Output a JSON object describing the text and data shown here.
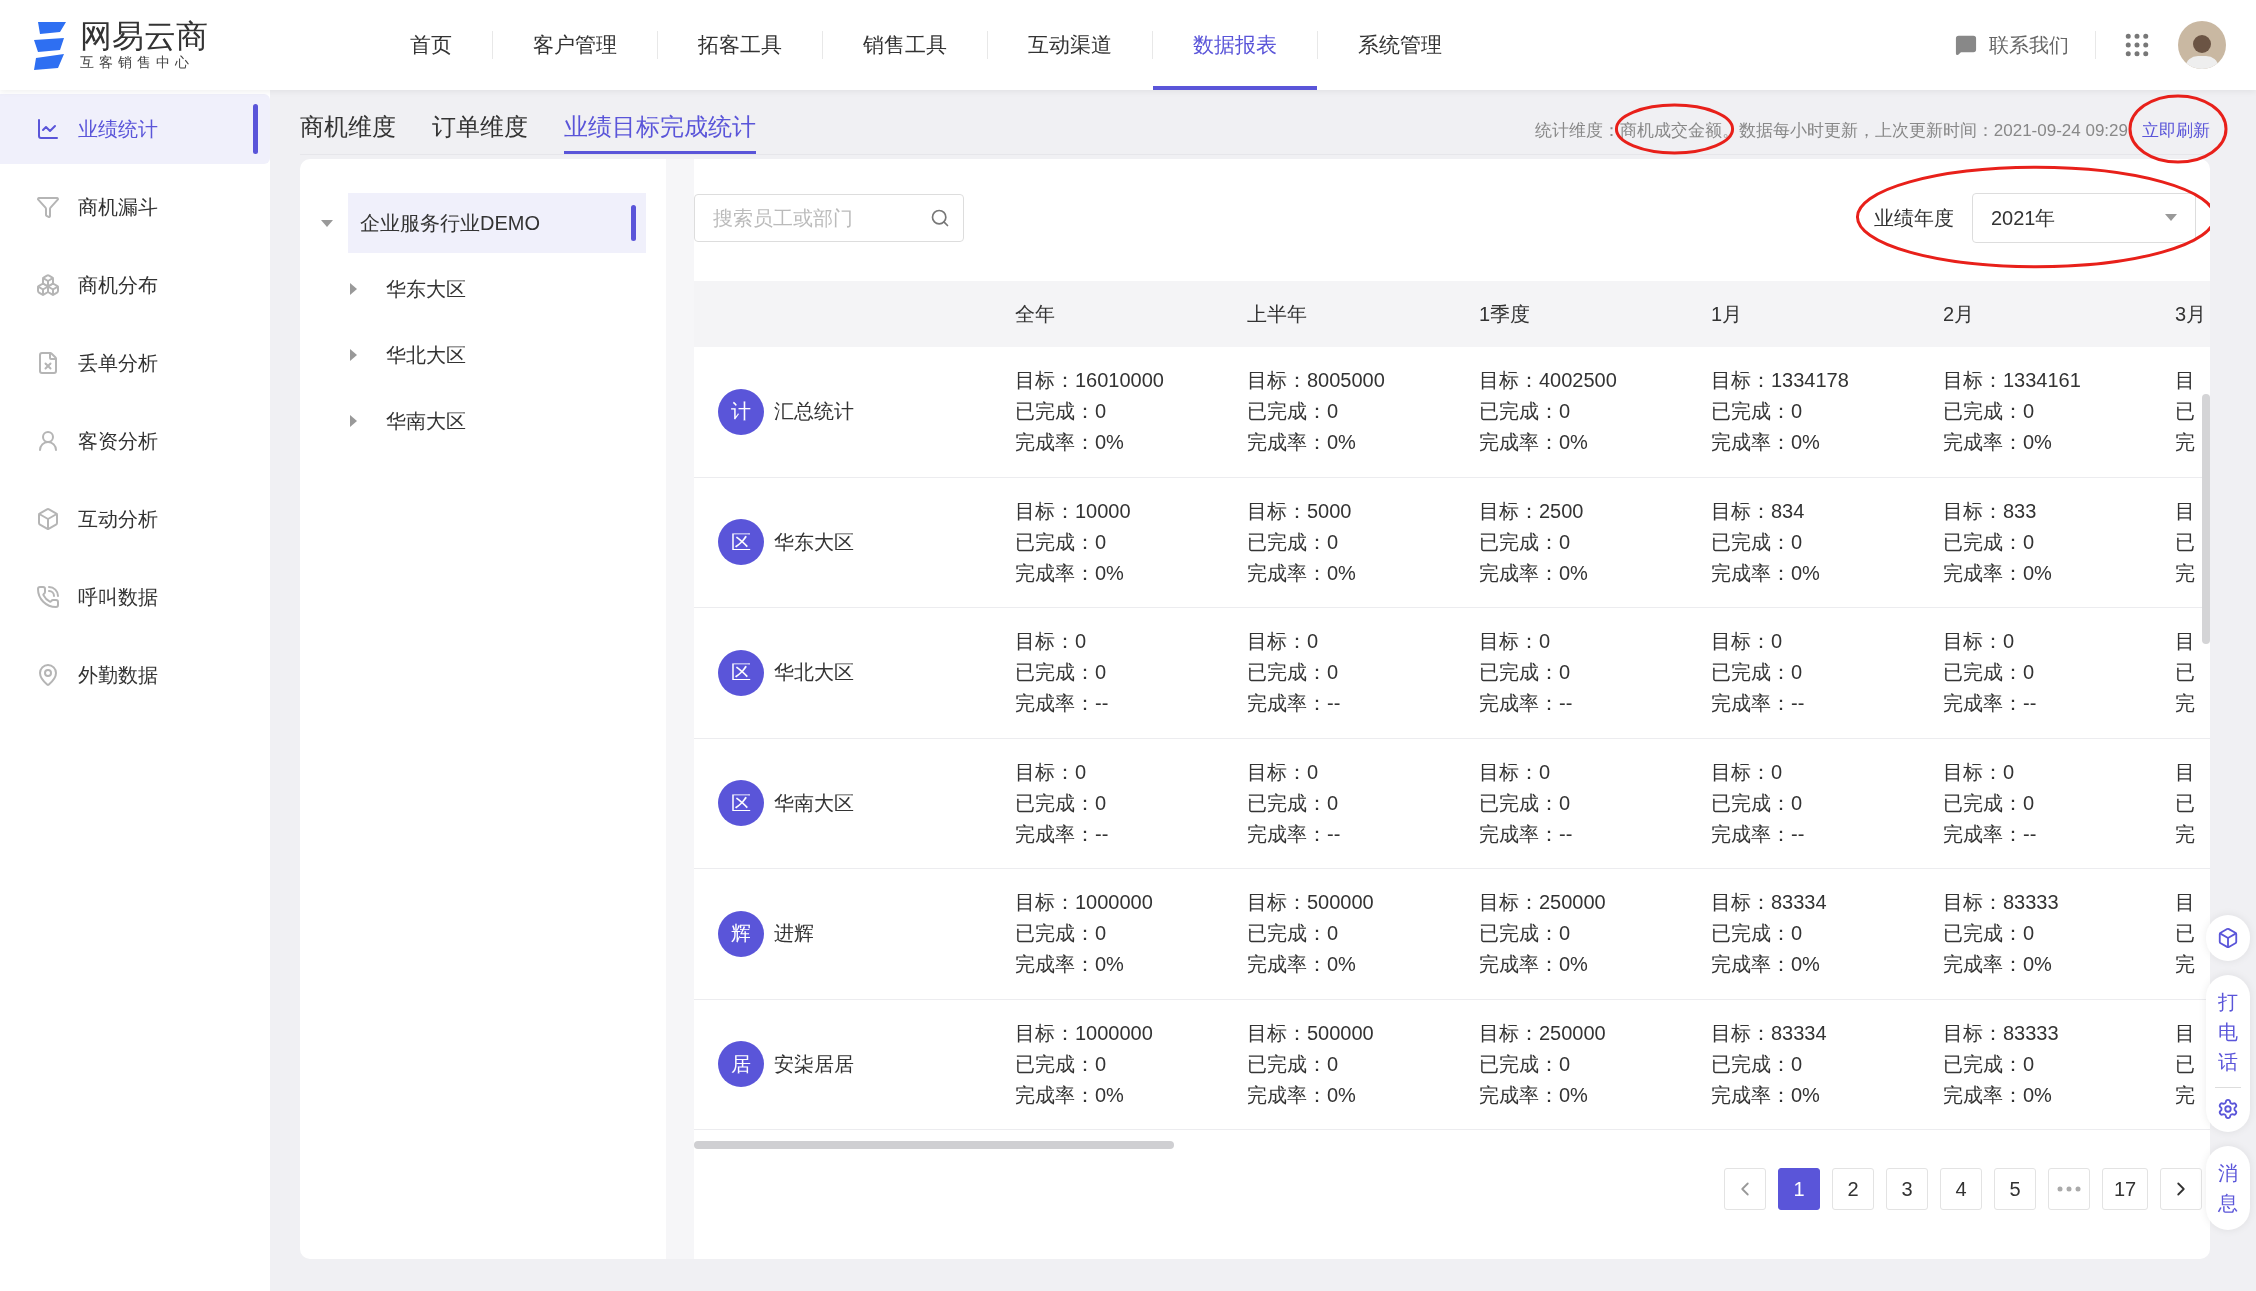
{
  "header": {
    "logo": {
      "name": "网易云商",
      "subtitle": "互客销售中心"
    },
    "nav": [
      {
        "label": "首页",
        "selected": false
      },
      {
        "label": "客户管理",
        "selected": false
      },
      {
        "label": "拓客工具",
        "selected": false
      },
      {
        "label": "销售工具",
        "selected": false
      },
      {
        "label": "互动渠道",
        "selected": false
      },
      {
        "label": "数据报表",
        "selected": true
      },
      {
        "label": "系统管理",
        "selected": false
      }
    ],
    "contact": "联系我们"
  },
  "sidebar": {
    "items": [
      {
        "label": "业绩统计",
        "selected": true
      },
      {
        "label": "商机漏斗",
        "selected": false
      },
      {
        "label": "商机分布",
        "selected": false
      },
      {
        "label": "丢单分析",
        "selected": false
      },
      {
        "label": "客资分析",
        "selected": false
      },
      {
        "label": "互动分析",
        "selected": false
      },
      {
        "label": "呼叫数据",
        "selected": false
      },
      {
        "label": "外勤数据",
        "selected": false
      }
    ]
  },
  "tabs": [
    {
      "label": "商机维度",
      "selected": false
    },
    {
      "label": "订单维度",
      "selected": false
    },
    {
      "label": "业绩目标完成统计",
      "selected": true
    }
  ],
  "status": {
    "text": "统计维度：商机成交金额。数据每小时更新，上次更新时间：2021-09-24 09:29",
    "circled": true,
    "refresh": "立即刷新",
    "refresh_circled": true
  },
  "tree": {
    "label": "企业服务行业DEMO",
    "expanded": true,
    "selected": true,
    "children": [
      {
        "label": "华东大区",
        "expanded": false,
        "selected": false
      },
      {
        "label": "华北大区",
        "expanded": false,
        "selected": false
      },
      {
        "label": "华南大区",
        "expanded": false,
        "selected": false
      }
    ]
  },
  "search": {
    "placeholder": "搜索员工或部门"
  },
  "year_filter": {
    "label": "业绩年度",
    "value": "2021年",
    "circled": true
  },
  "table": {
    "columns": [
      "全年",
      "上半年",
      "1季度",
      "1月",
      "2月",
      "3月"
    ],
    "rows": [
      {
        "badge": "计",
        "name": "汇总统计",
        "cells": [
          [
            "目标：16010000",
            "已完成：0",
            "完成率：0%"
          ],
          [
            "目标：8005000",
            "已完成：0",
            "完成率：0%"
          ],
          [
            "目标：4002500",
            "已完成：0",
            "完成率：0%"
          ],
          [
            "目标：1334178",
            "已完成：0",
            "完成率：0%"
          ],
          [
            "目标：1334161",
            "已完成：0",
            "完成率：0%"
          ],
          [
            "目",
            "已",
            "完"
          ]
        ]
      },
      {
        "badge": "区",
        "name": "华东大区",
        "cells": [
          [
            "目标：10000",
            "已完成：0",
            "完成率：0%"
          ],
          [
            "目标：5000",
            "已完成：0",
            "完成率：0%"
          ],
          [
            "目标：2500",
            "已完成：0",
            "完成率：0%"
          ],
          [
            "目标：834",
            "已完成：0",
            "完成率：0%"
          ],
          [
            "目标：833",
            "已完成：0",
            "完成率：0%"
          ],
          [
            "目",
            "已",
            "完"
          ]
        ]
      },
      {
        "badge": "区",
        "name": "华北大区",
        "cells": [
          [
            "目标：0",
            "已完成：0",
            "完成率：--"
          ],
          [
            "目标：0",
            "已完成：0",
            "完成率：--"
          ],
          [
            "目标：0",
            "已完成：0",
            "完成率：--"
          ],
          [
            "目标：0",
            "已完成：0",
            "完成率：--"
          ],
          [
            "目标：0",
            "已完成：0",
            "完成率：--"
          ],
          [
            "目",
            "已",
            "完"
          ]
        ]
      },
      {
        "badge": "区",
        "name": "华南大区",
        "cells": [
          [
            "目标：0",
            "已完成：0",
            "完成率：--"
          ],
          [
            "目标：0",
            "已完成：0",
            "完成率：--"
          ],
          [
            "目标：0",
            "已完成：0",
            "完成率：--"
          ],
          [
            "目标：0",
            "已完成：0",
            "完成率：--"
          ],
          [
            "目标：0",
            "已完成：0",
            "完成率：--"
          ],
          [
            "目",
            "已",
            "完"
          ]
        ]
      },
      {
        "badge": "辉",
        "name": "进辉",
        "cells": [
          [
            "目标：1000000",
            "已完成：0",
            "完成率：0%"
          ],
          [
            "目标：500000",
            "已完成：0",
            "完成率：0%"
          ],
          [
            "目标：250000",
            "已完成：0",
            "完成率：0%"
          ],
          [
            "目标：83334",
            "已完成：0",
            "完成率：0%"
          ],
          [
            "目标：83333",
            "已完成：0",
            "完成率：0%"
          ],
          [
            "目",
            "已",
            "完"
          ]
        ]
      },
      {
        "badge": "居",
        "name": "安柒居居",
        "cells": [
          [
            "目标：1000000",
            "已完成：0",
            "完成率：0%"
          ],
          [
            "目标：500000",
            "已完成：0",
            "完成率：0%"
          ],
          [
            "目标：250000",
            "已完成：0",
            "完成率：0%"
          ],
          [
            "目标：83334",
            "已完成：0",
            "完成率：0%"
          ],
          [
            "目标：83333",
            "已完成：0",
            "完成率：0%"
          ],
          [
            "目",
            "已",
            "完"
          ]
        ]
      }
    ]
  },
  "pagination": [
    {
      "kind": "page",
      "label": "1",
      "selected": true
    },
    {
      "kind": "page",
      "label": "2",
      "selected": false
    },
    {
      "kind": "page",
      "label": "3",
      "selected": false
    },
    {
      "kind": "page",
      "label": "4",
      "selected": false
    },
    {
      "kind": "page",
      "label": "5",
      "selected": false
    },
    {
      "kind": "more"
    },
    {
      "kind": "page",
      "label": "17",
      "selected": false
    }
  ],
  "float_tools": {
    "call": "打电话",
    "message": "消息"
  }
}
